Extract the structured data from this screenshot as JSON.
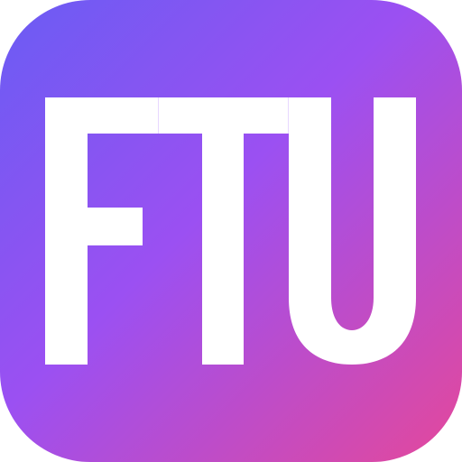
{
  "logo": {
    "text": "FTU",
    "letters": [
      "F",
      "T",
      "U"
    ]
  },
  "colors": {
    "gradient_start": "#6A5CF3",
    "gradient_mid": "#9B50F2",
    "gradient_end": "#E4489B",
    "glyph": "#FFFFFF"
  },
  "icon_name": "ftu-app-icon"
}
